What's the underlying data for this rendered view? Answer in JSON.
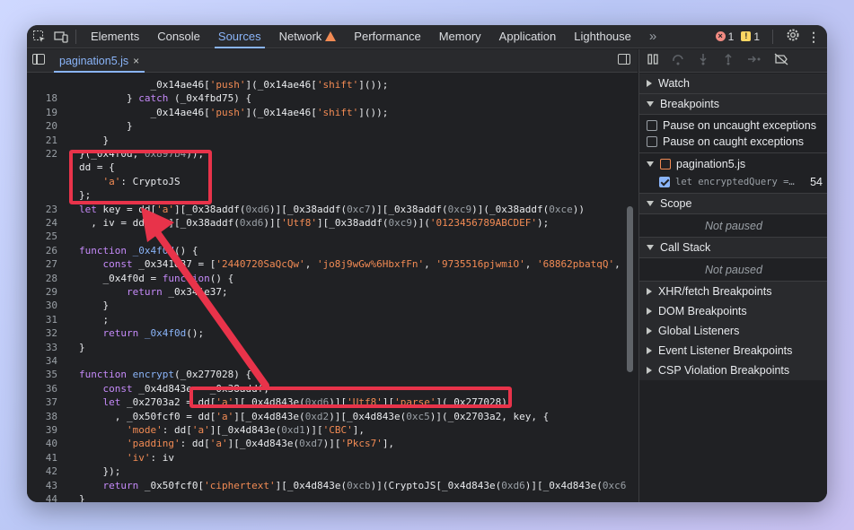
{
  "toolbar": {
    "tabs": [
      "Elements",
      "Console",
      "Sources",
      "Network",
      "Performance",
      "Memory",
      "Application",
      "Lighthouse"
    ],
    "active_tab": "Sources",
    "more": "»",
    "errors": "1",
    "warnings": "1"
  },
  "file_tab": {
    "name": "pagination5.js",
    "close": "×"
  },
  "code_lines": [
    {
      "n": "",
      "text": "            _0x14ae46['push'](_0x14ae46['shift']());"
    },
    {
      "n": "18",
      "text": "        } catch (_0x4fbd75) {"
    },
    {
      "n": "19",
      "text": "            _0x14ae46['push'](_0x14ae46['shift']());"
    },
    {
      "n": "20",
      "text": "        }"
    },
    {
      "n": "21",
      "text": "    }"
    },
    {
      "n": "22",
      "text": "}(_0x4f0d, 0x897b4));"
    },
    {
      "n": "",
      "text": "dd = {"
    },
    {
      "n": "",
      "text": "    'a': CryptoJS"
    },
    {
      "n": "",
      "text": "};"
    },
    {
      "n": "23",
      "text": "let key = dd['a'][_0x38addf(0xd6)][_0x38addf(0xc7)][_0x38addf(0xc9)](_0x38addf(0xce))"
    },
    {
      "n": "24",
      "text": "  , iv = dd['a'][_0x38addf(0xd6)]['Utf8'][_0x38addf(0xc9)]('0123456789ABCDEF');"
    },
    {
      "n": "25",
      "text": ""
    },
    {
      "n": "26",
      "text": "function _0x4f0d() {"
    },
    {
      "n": "27",
      "text": "    const _0x341e37 = ['2440720SaQcQw', 'jo8j9wGw%6HbxfFn', '9735516pjwmiO', '68862pbatqQ',"
    },
    {
      "n": "28",
      "text": "    _0x4f0d = function() {"
    },
    {
      "n": "29",
      "text": "        return _0x341e37;"
    },
    {
      "n": "30",
      "text": "    }"
    },
    {
      "n": "31",
      "text": "    ;"
    },
    {
      "n": "32",
      "text": "    return _0x4f0d();"
    },
    {
      "n": "33",
      "text": "}"
    },
    {
      "n": "34",
      "text": ""
    },
    {
      "n": "35",
      "text": "function encrypt(_0x277028) {"
    },
    {
      "n": "36",
      "text": "    const _0x4d843e = _0x38addf;"
    },
    {
      "n": "37",
      "text": "    let _0x2703a2 = dd['a'][_0x4d843e(0xd6)]['Utf8']['parse'](_0x277028)"
    },
    {
      "n": "38",
      "text": "      , _0x50fcf0 = dd['a'][_0x4d843e(0xd2)][_0x4d843e(0xc5)](_0x2703a2, key, {"
    },
    {
      "n": "39",
      "text": "        'mode': dd['a'][_0x4d843e(0xd1)]['CBC'],"
    },
    {
      "n": "40",
      "text": "        'padding': dd['a'][_0x4d843e(0xd7)]['Pkcs7'],"
    },
    {
      "n": "41",
      "text": "        'iv': iv"
    },
    {
      "n": "42",
      "text": "    });"
    },
    {
      "n": "43",
      "text": "    return _0x50fcf0['ciphertext'][_0x4d843e(0xcb)](CryptoJS[_0x4d843e(0xd6)][_0x4d843e(0xc6"
    },
    {
      "n": "44",
      "text": "}"
    }
  ],
  "sidebar": {
    "watch": "Watch",
    "breakpoints": "Breakpoints",
    "pause_uncaught": "Pause on uncaught exceptions",
    "pause_caught": "Pause on caught exceptions",
    "bp_file": "pagination5.js",
    "bp_code": "let encryptedQuery =…",
    "bp_line": "54",
    "scope": "Scope",
    "scope_status": "Not paused",
    "call_stack": "Call Stack",
    "call_stack_status": "Not paused",
    "xhr": "XHR/fetch Breakpoints",
    "dom": "DOM Breakpoints",
    "global": "Global Listeners",
    "event": "Event Listener Breakpoints",
    "csp": "CSP Violation Breakpoints"
  },
  "colors": {
    "annotation": "#e8334a",
    "accent": "#8ab4f8"
  }
}
